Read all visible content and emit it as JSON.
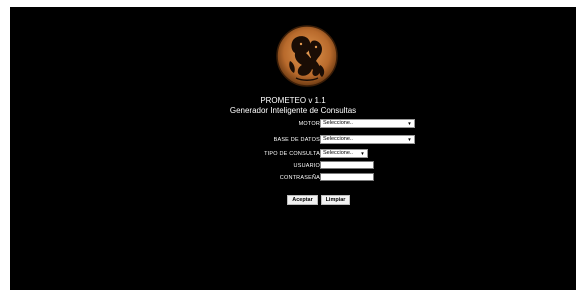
{
  "app": {
    "title": "PROMETEO v 1.1",
    "subtitle": "Generador Inteligente de Consultas"
  },
  "form": {
    "motor": {
      "label": "Motor",
      "value": "Seleccione.."
    },
    "base_datos": {
      "label": "Base de Datos",
      "value": "Seleccione.."
    },
    "tipo_consulta": {
      "label": "Tipo de Consulta",
      "value": "Seleccione.."
    },
    "usuario": {
      "label": "Usuario",
      "value": ""
    },
    "contrasena": {
      "label": "Contraseña",
      "value": ""
    }
  },
  "buttons": {
    "aceptar": "Aceptar",
    "limpiar": "Limpiar"
  },
  "icons": {
    "logo": "greek-vase-figure-emblem",
    "dropdown": "chevron-down-icon"
  },
  "colors": {
    "background": "#000000",
    "text": "#ffffff",
    "emblem": "#c87a3a"
  }
}
